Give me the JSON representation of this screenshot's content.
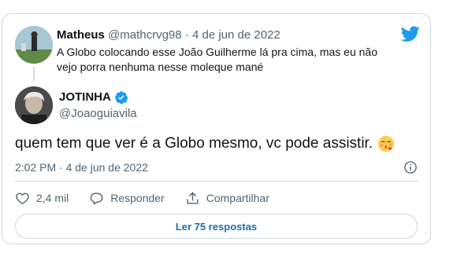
{
  "reply_to": {
    "name": "Matheus",
    "handle": "@mathcrvg98",
    "separator": "·",
    "date": "4 de jun de 2022",
    "text": "A Globo colocando esse João Guilherme lá pra cima, mas eu não vejo porra nenhuma nesse moleque mané"
  },
  "author": {
    "name": "JOTINHA",
    "handle": "@Joaoguiavila",
    "verified": true
  },
  "tweet": {
    "text": "quem tem que ver é a Globo mesmo, vc pode assistir.",
    "emoji": "kissing-face-icon"
  },
  "timestamp": "2:02 PM · 4 de jun de 2022",
  "actions": {
    "likes": "2,4 mil",
    "reply_label": "Responder",
    "share_label": "Compartilhar"
  },
  "more_button": "Ler 75 respostas",
  "colors": {
    "twitter_blue": "#1d9bf0",
    "link_blue": "#1d6fa5",
    "border": "#cfd9de",
    "muted": "#536471"
  }
}
